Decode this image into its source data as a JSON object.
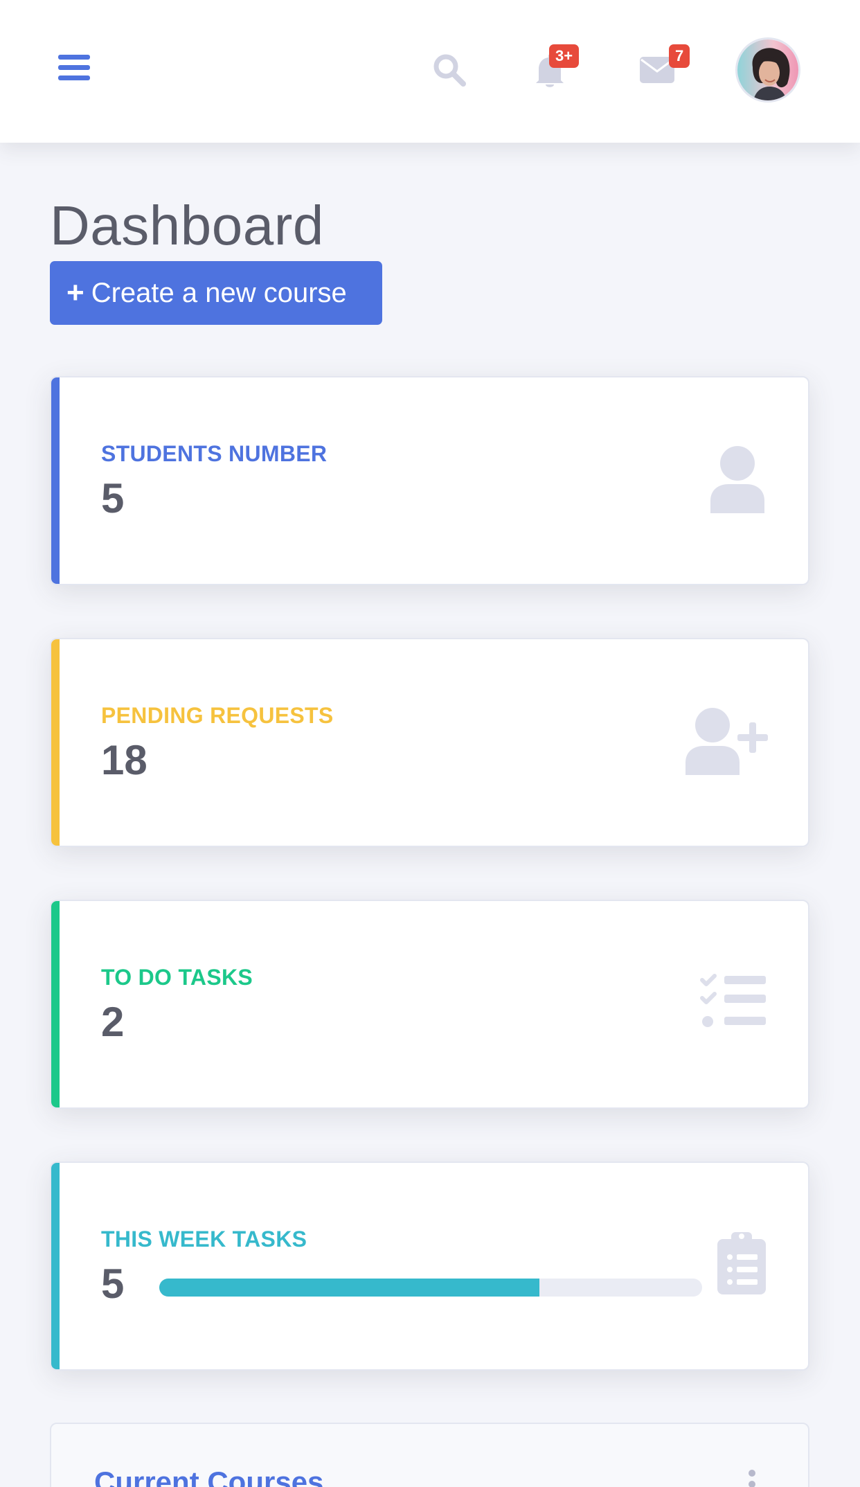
{
  "topbar": {
    "alerts_badge": "3+",
    "messages_badge": "7",
    "icons": [
      "menu-icon",
      "search-icon",
      "bell-icon",
      "envelope-icon",
      "user-avatar"
    ]
  },
  "header": {
    "title": "Dashboard",
    "create_button_label": "Create a new course"
  },
  "cards": {
    "students": {
      "label": "STUDENTS NUMBER",
      "value": "5",
      "accent": "#4e73df",
      "icon": "user-icon"
    },
    "pending": {
      "label": "PENDING REQUESTS",
      "value": "18",
      "accent": "#f6c23e",
      "icon": "user-plus-icon"
    },
    "todo": {
      "label": "TO DO TASKS",
      "value": "2",
      "accent": "#1cc88a",
      "icon": "tasks-list-icon"
    },
    "week": {
      "label": "THIS WEEK TASKS",
      "value": "5",
      "accent": "#36b9cc",
      "icon": "clipboard-list-icon",
      "progress_percent": 70
    }
  },
  "courses": {
    "title": "Current Courses"
  },
  "colors": {
    "primary": "#4e73df",
    "warning": "#f6c23e",
    "success": "#1cc88a",
    "info": "#36b9cc",
    "danger": "#e74a3b",
    "icon_muted": "#dddfeb"
  }
}
